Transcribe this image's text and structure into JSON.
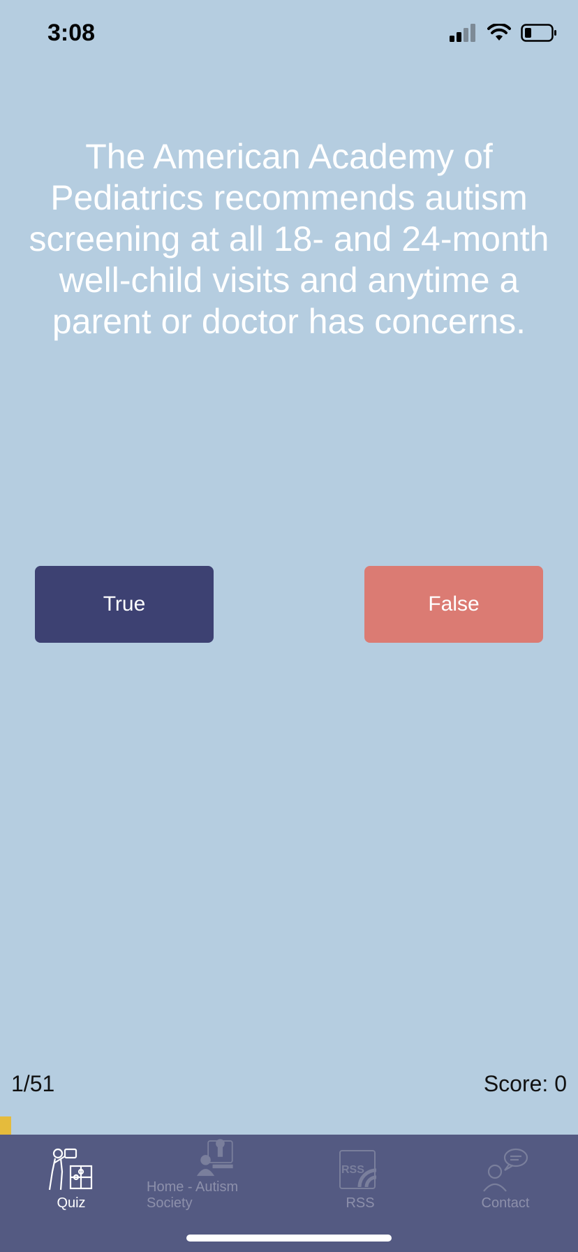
{
  "status_bar": {
    "time": "3:08"
  },
  "question": {
    "text": "The American Academy of Pediatrics recommends autism screening at all 18- and 24-month well-child visits and anytime a parent or doctor has concerns."
  },
  "answers": {
    "true_label": "True",
    "false_label": "False"
  },
  "footer": {
    "counter": "1/51",
    "score": "Score: 0"
  },
  "progress": {
    "current": 1,
    "total": 51
  },
  "tab_bar": {
    "tabs": [
      {
        "label": "Quiz",
        "icon": "quiz-icon",
        "active": true
      },
      {
        "label": "Home - Autism Society",
        "icon": "home-icon",
        "active": false
      },
      {
        "label": "RSS",
        "icon": "rss-icon",
        "active": false
      },
      {
        "label": "Contact",
        "icon": "contact-icon",
        "active": false
      }
    ]
  },
  "colors": {
    "background": "#b5cde0",
    "true_button": "#3d4172",
    "false_button": "#db7b73",
    "tab_bar": "#545a82",
    "progress": "#e5bb3c"
  }
}
